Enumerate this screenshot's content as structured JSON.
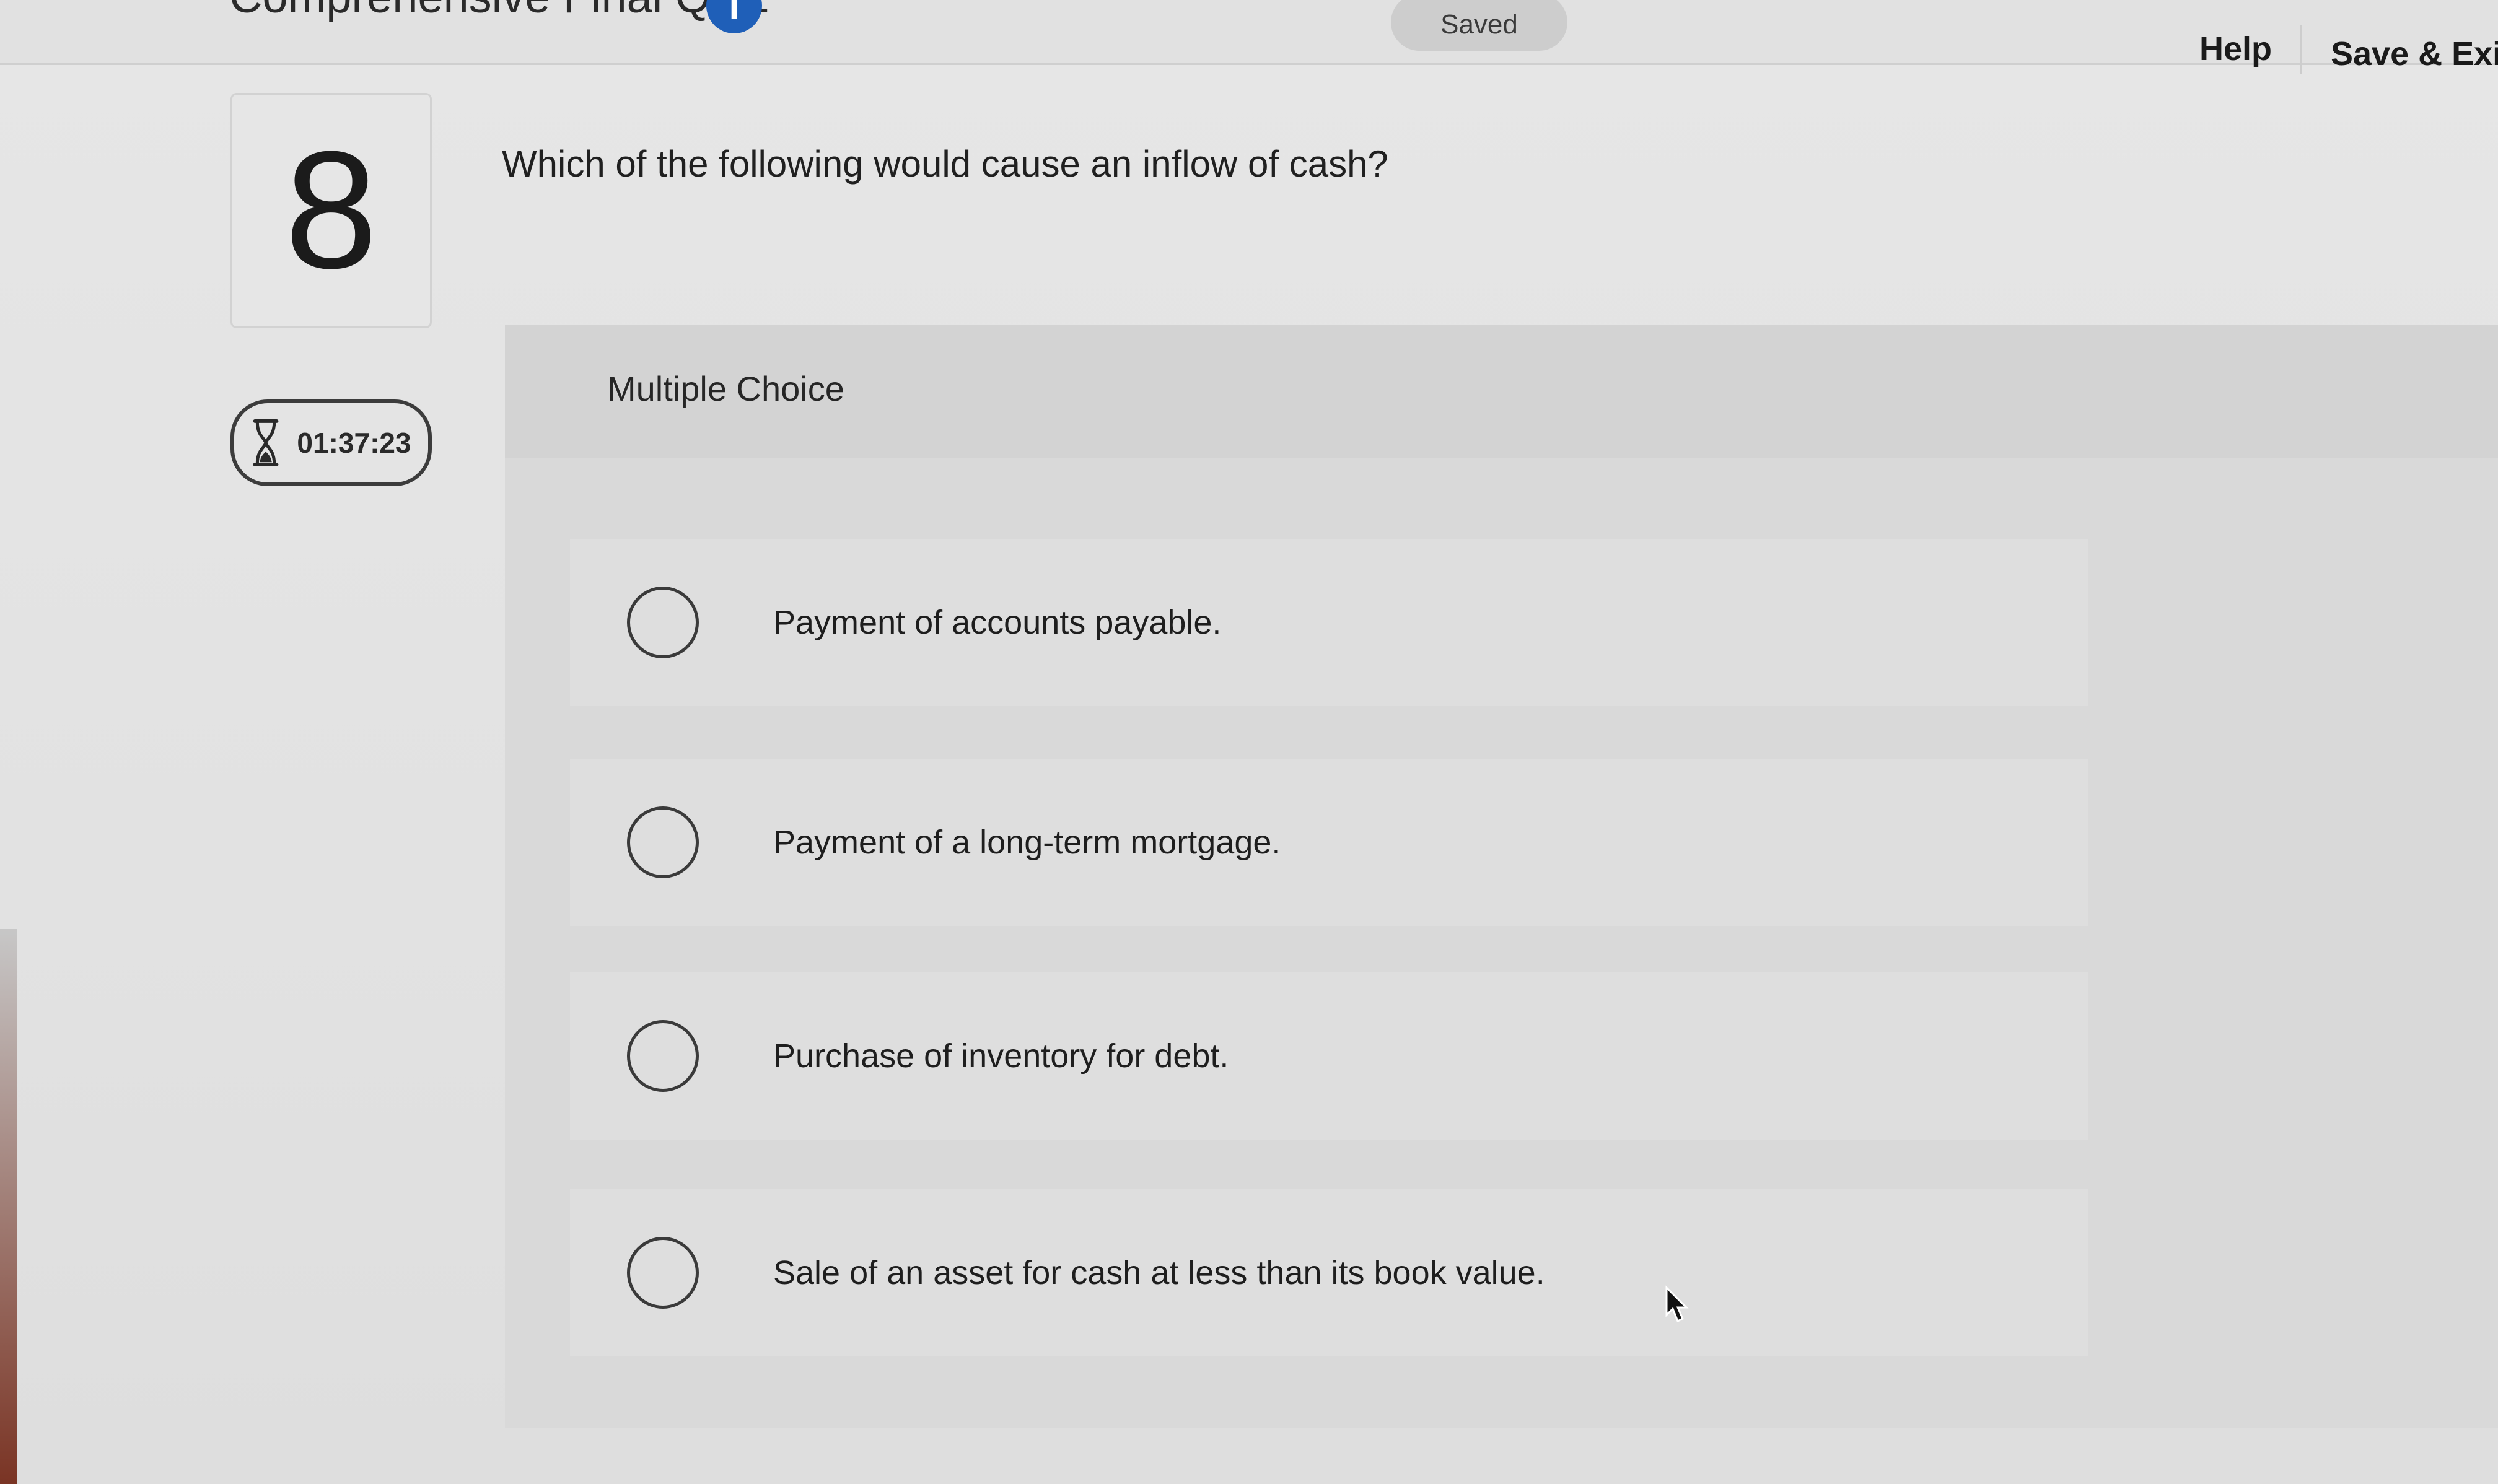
{
  "header": {
    "quiz_title": "Comprehensive Final Quiz",
    "info_icon_glyph": "i",
    "saved_label": "Saved",
    "help_label": "Help",
    "save_exit_label": "Save & Exit"
  },
  "question": {
    "number": "8",
    "prompt": "Which of the following would cause an inflow of cash?",
    "type_label": "Multiple Choice"
  },
  "timer": {
    "icon": "hourglass-icon",
    "value": "01:37:23"
  },
  "choices": [
    {
      "label": "Payment of accounts payable.",
      "selected": false
    },
    {
      "label": "Payment of a long-term mortgage.",
      "selected": false
    },
    {
      "label": "Purchase of inventory for debt.",
      "selected": false
    },
    {
      "label": "Sale of an asset for cash at less than its book value.",
      "selected": false
    }
  ],
  "colors": {
    "info_icon": "#1f5fb8",
    "background": "#e3e3e3",
    "panel": "#d9d9d9"
  }
}
